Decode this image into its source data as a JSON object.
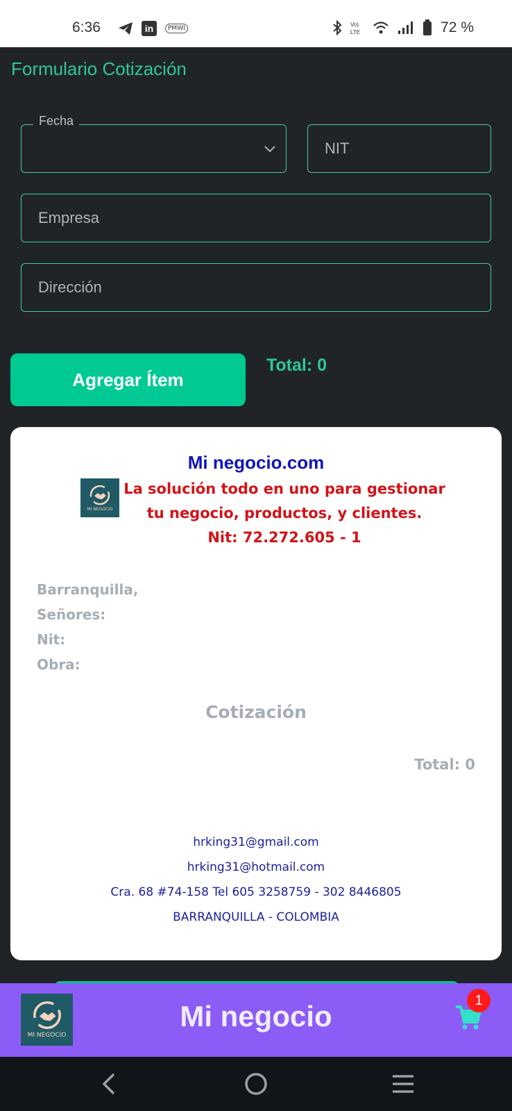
{
  "status_bar": {
    "time": "6:36",
    "linkedin": "in",
    "small_tag": "PMWI",
    "battery": "72 %",
    "icons": [
      "telegram-icon",
      "linkedin-icon",
      "notification-icon",
      "bluetooth-icon",
      "volte-icon",
      "wifi-icon",
      "signal-icon",
      "battery-icon"
    ]
  },
  "form": {
    "title": "Formulario Cotización",
    "fecha_label": "Fecha",
    "fecha_value": "",
    "nit_placeholder": "NIT",
    "empresa_placeholder": "Empresa",
    "direccion_placeholder": "Dirección",
    "add_button": "Agregar Ítem",
    "total": "Total: 0"
  },
  "preview": {
    "brand": "Mi negocio.com",
    "logo_text": "MI NEGOCIO",
    "slogan_line1": "La solución todo en uno para gestionar",
    "slogan_line2": "tu negocio, productos, y clientes.",
    "nit": "Nit: 72.272.605 - 1",
    "city": "Barranquilla,",
    "senores": "Señores:",
    "nit_label": "Nit:",
    "obra": "Obra:",
    "title": "Cotización",
    "total": "Total: 0",
    "email1": "hrking31@gmail.com",
    "email2": "hrking31@hotmail.com",
    "address": "Cra. 68 #74-158 Tel 605 3258759 - 302 8446805",
    "location": "BARRANQUILLA - COLOMBIA"
  },
  "app_bar": {
    "logo_text": "MI NEGOCIO",
    "title": "Mi negocio",
    "cart_count": "1"
  },
  "colors": {
    "accent": "#00c994",
    "background": "#202429",
    "app_bar": "#8b5cf6",
    "brand_blue": "#1014b8",
    "slogan_red": "#d11418"
  }
}
